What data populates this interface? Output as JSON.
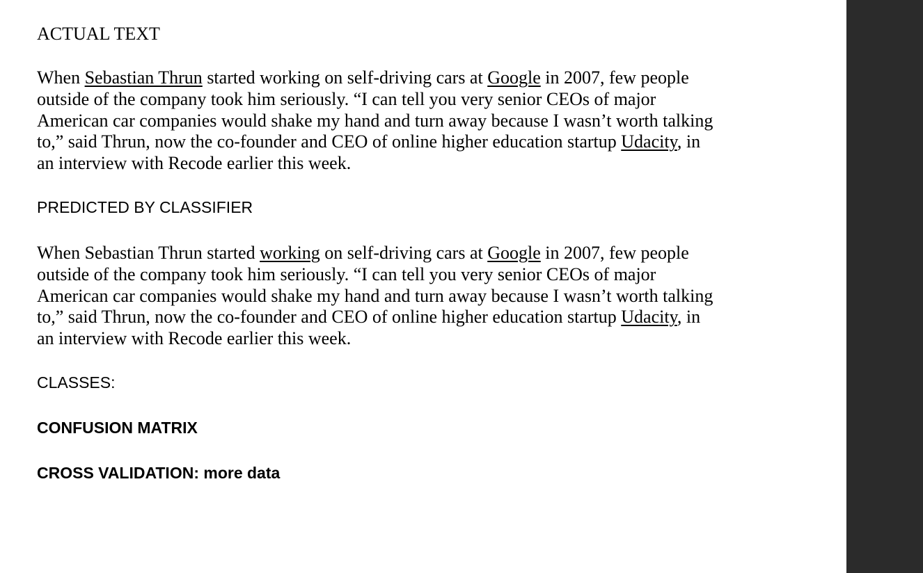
{
  "headings": {
    "actual_text": "ACTUAL TEXT",
    "predicted_by_classifier": "PREDICTED BY CLASSIFIER",
    "classes": "CLASSES:",
    "confusion_matrix": "CONFUSION MATRIX",
    "cross_validation": "CROSS VALIDATION: more data"
  },
  "actual_paragraph": {
    "l1_a": "When ",
    "l1_u1": "Sebastian Thrun",
    "l1_b": " started working on self-driving cars at ",
    "l1_u2": "Google",
    "l1_c": " in 2007, few people",
    "l2": "outside of the company took him seriously. “I can tell you very senior CEOs of major",
    "l3": "American car companies would shake my hand and turn away because I wasn’t worth talking",
    "l4_a": "to,” said Thrun, now the co-founder and CEO of online higher education startup ",
    "l4_u": "Udacity",
    "l4_b": ", in",
    "l5": "an interview with Recode earlier this week."
  },
  "predicted_paragraph": {
    "l1_a": "When Sebastian Thrun started ",
    "l1_u1": "working",
    "l1_b": " on self-driving cars at ",
    "l1_u2": "Google",
    "l1_c": " in 2007, few people",
    "l2": "outside of the company took him seriously. “I can tell you very senior CEOs of major",
    "l3": "American car companies would shake my hand and turn away because I wasn’t worth talking",
    "l4_a": "to,” said Thrun, now the co-founder and CEO of online higher education startup ",
    "l4_u": "Udacity",
    "l4_b": ", in",
    "l5": "an interview with Recode earlier this week."
  },
  "colors": {
    "page_background": "#ffffff",
    "side_panel": "#2b2b2b",
    "text": "#000000"
  }
}
